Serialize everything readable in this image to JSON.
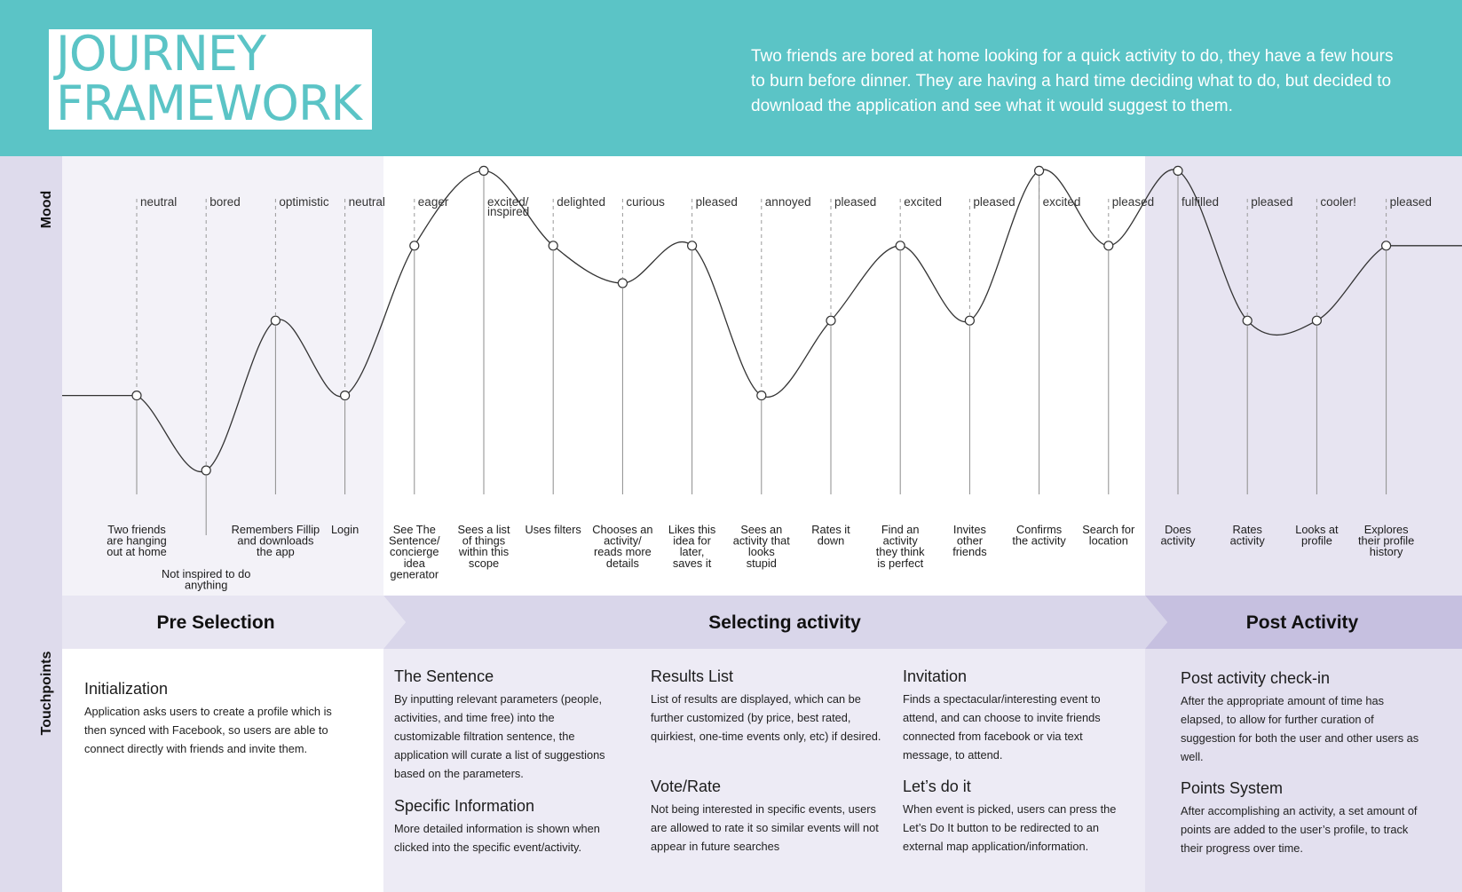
{
  "header": {
    "title_line1": "JOURNEY",
    "title_line2": "FRAMEWORK",
    "intro": "Two friends are bored at home looking for a quick activity to do, they have a few hours to burn before dinner. They are having a hard time deciding what to do, but decided to download the application and see what it would suggest to them.",
    "accent_color": "#5bc4c6"
  },
  "side_labels": {
    "mood": "Mood",
    "touchpoints": "Touchpoints"
  },
  "steps": [
    {
      "mood": [
        "neutral"
      ],
      "level": 3,
      "event": [
        "Two friends",
        "are hanging",
        "out at home"
      ]
    },
    {
      "mood": [
        "bored"
      ],
      "level": 1,
      "event": [
        "Not inspired to do",
        "anything"
      ]
    },
    {
      "mood": [
        "optimistic"
      ],
      "level": 5,
      "event": [
        "Remembers Fillip",
        "and downloads",
        "the app"
      ]
    },
    {
      "mood": [
        "neutral"
      ],
      "level": 3,
      "event": [
        "Login"
      ]
    },
    {
      "mood": [
        "eager"
      ],
      "level": 7,
      "event": [
        "See The",
        "Sentence/",
        "concierge",
        "idea",
        "generator"
      ]
    },
    {
      "mood": [
        "excited/",
        "inspired"
      ],
      "level": 9,
      "event": [
        "Sees a list",
        "of things",
        "within this",
        "scope"
      ]
    },
    {
      "mood": [
        "delighted"
      ],
      "level": 7,
      "event": [
        "Uses filters"
      ]
    },
    {
      "mood": [
        "curious"
      ],
      "level": 6,
      "event": [
        "Chooses an",
        "activity/",
        "reads more",
        "details"
      ]
    },
    {
      "mood": [
        "pleased"
      ],
      "level": 7,
      "event": [
        "Likes this",
        "idea for",
        "later,",
        "saves it"
      ]
    },
    {
      "mood": [
        "annoyed"
      ],
      "level": 3,
      "event": [
        "Sees an",
        "activity that",
        "looks",
        "stupid"
      ]
    },
    {
      "mood": [
        "pleased"
      ],
      "level": 5,
      "event": [
        "Rates it",
        "down"
      ]
    },
    {
      "mood": [
        "excited"
      ],
      "level": 7,
      "event": [
        "Find an",
        "activity",
        "they think",
        "is perfect"
      ]
    },
    {
      "mood": [
        "pleased"
      ],
      "level": 5,
      "event": [
        "Invites",
        "other",
        "friends"
      ]
    },
    {
      "mood": [
        "excited"
      ],
      "level": 9,
      "event": [
        "Confirms",
        "the activity"
      ]
    },
    {
      "mood": [
        "pleased"
      ],
      "level": 7,
      "event": [
        "Search for",
        "location"
      ]
    },
    {
      "mood": [
        "fulfilled"
      ],
      "level": 9,
      "event": [
        "Does",
        "activity"
      ]
    },
    {
      "mood": [
        "pleased"
      ],
      "level": 5,
      "event": [
        "Rates",
        "activity"
      ]
    },
    {
      "mood": [
        "cooler!"
      ],
      "level": 5,
      "event": [
        "Looks at",
        "profile"
      ]
    },
    {
      "mood": [
        "pleased"
      ],
      "level": 7,
      "event": [
        "Explores",
        "their profile",
        "history"
      ]
    }
  ],
  "phases": [
    "Pre Selection",
    "Selecting activity",
    "Post Activity"
  ],
  "touchpoints": {
    "initialization": {
      "title": "Initialization",
      "text": "Application asks users to create a profile which is then synced with Facebook, so users are able to connect directly with friends and invite them."
    },
    "sentence": {
      "title": "The Sentence",
      "text": "By inputting relevant parameters (people, activities, and time free) into the customizable filtration sentence, the application will curate a list of suggestions based on the parameters."
    },
    "specific": {
      "title": "Specific Information",
      "text": "More detailed information is shown when clicked into the specific event/activity."
    },
    "results": {
      "title": "Results List",
      "text": "List of results are displayed, which can be further customized (by price, best rated, quirkiest, one-time events only, etc) if desired."
    },
    "vote": {
      "title": "Vote/Rate",
      "text": "Not being interested in specific events, users are allowed to rate it so similar events will not appear in future searches"
    },
    "invitation": {
      "title": "Invitation",
      "text": "Finds a spectacular/interesting event to attend, and can choose to invite friends connected from facebook or via text message, to attend."
    },
    "letsdo": {
      "title": "Let’s do it",
      "text": "When event is picked, users can press the Let’s Do It button to be redirected to an external map application/information."
    },
    "checkin": {
      "title": "Post activity check-in",
      "text": "After the appropriate amount of time has elapsed, to allow for further curation of suggestion for both the user and other users as well."
    },
    "points": {
      "title": "Points System",
      "text": "After accomplishing an activity, a set amount of points are added to the user’s profile, to track their progress over time."
    }
  }
}
